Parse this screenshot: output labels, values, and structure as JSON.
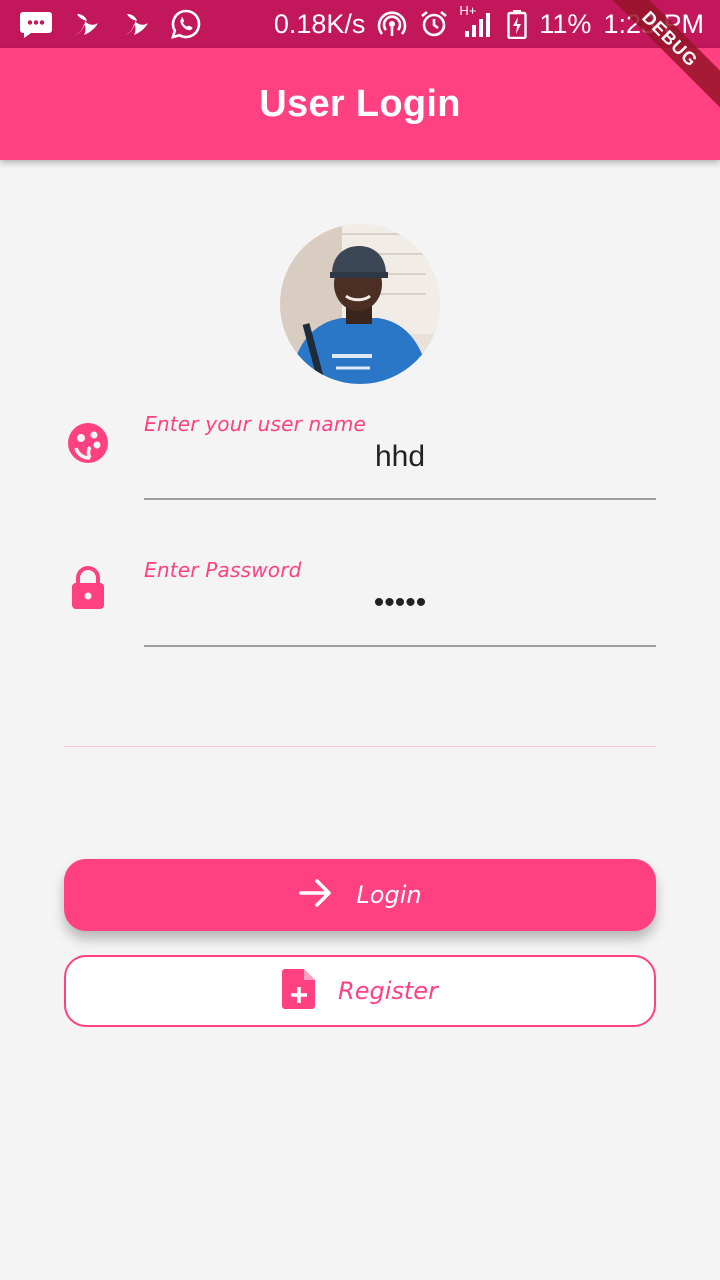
{
  "status_bar": {
    "network_speed": "0.18K/s",
    "network_type": "H+",
    "battery": "11%",
    "time": "1:23 PM",
    "icons": [
      "message-icon",
      "bird-app-icon",
      "bird-app-icon",
      "whatsapp-icon",
      "hotspot-icon",
      "alarm-icon",
      "signal-icon",
      "battery-charging-icon"
    ]
  },
  "app_bar": {
    "title": "User Login"
  },
  "debug_banner": "DEBUG",
  "avatar": {
    "icon": "profile-photo"
  },
  "username_field": {
    "label": "Enter your user name",
    "value": "hhd",
    "icon": "face-icon"
  },
  "password_field": {
    "label": "Enter Password",
    "value": "•••••",
    "icon": "lock-icon"
  },
  "buttons": {
    "login": {
      "label": "Login",
      "icon": "arrow-forward-icon"
    },
    "register": {
      "label": "Register",
      "icon": "note-add-icon"
    }
  },
  "colors": {
    "primary": "#ff4081",
    "status_bar": "#c2185b",
    "background": "#f4f4f4"
  }
}
